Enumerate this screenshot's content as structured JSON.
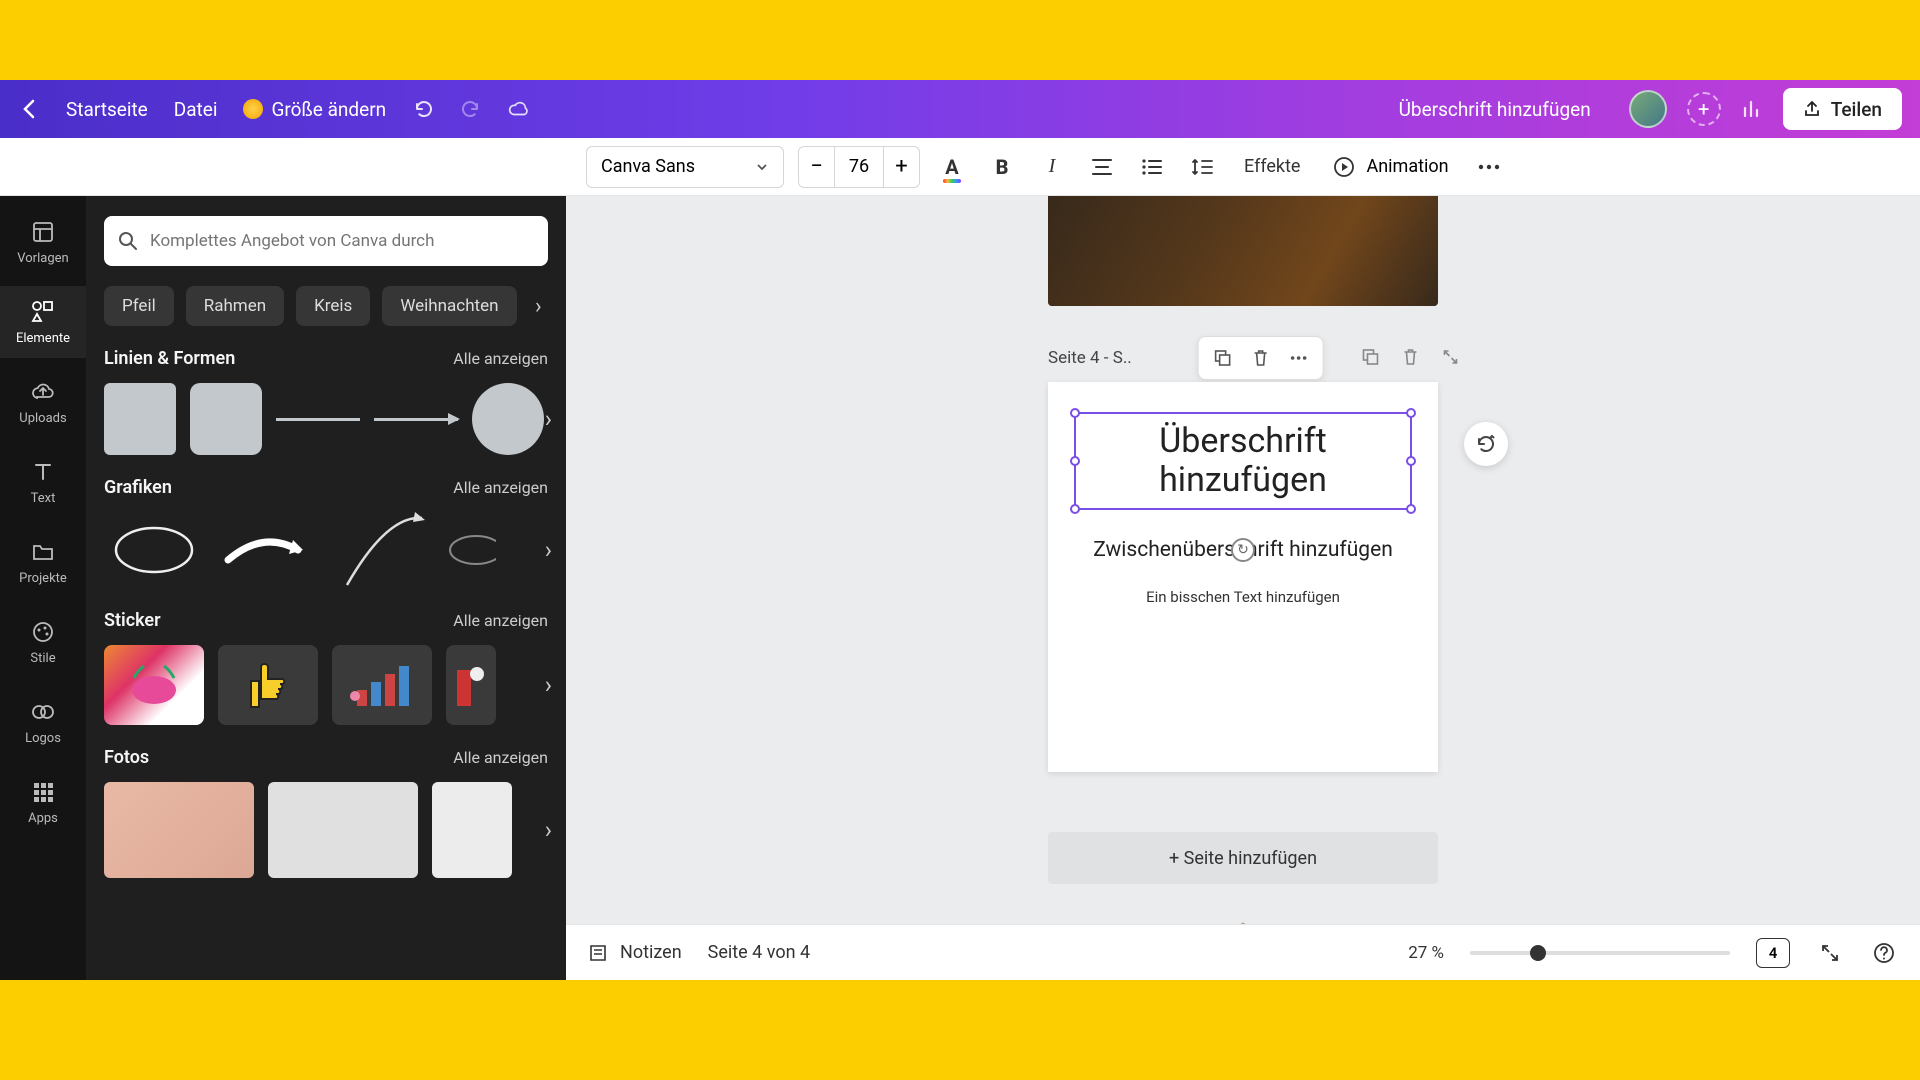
{
  "header": {
    "home": "Startseite",
    "file": "Datei",
    "resize": "Größe ändern",
    "doc_title": "Überschrift hinzufügen",
    "share": "Teilen"
  },
  "toolbar": {
    "font": "Canva Sans",
    "size": "76",
    "minus": "−",
    "plus": "+",
    "effects": "Effekte",
    "animation": "Animation"
  },
  "rail": {
    "templates": "Vorlagen",
    "elements": "Elemente",
    "uploads": "Uploads",
    "text": "Text",
    "projects": "Projekte",
    "styles": "Stile",
    "logos": "Logos",
    "apps": "Apps"
  },
  "panel": {
    "search_placeholder": "Komplettes Angebot von Canva durch",
    "chips": [
      "Pfeil",
      "Rahmen",
      "Kreis",
      "Weihnachten"
    ],
    "see_all": "Alle anzeigen",
    "sections": {
      "lines": "Linien & Formen",
      "graphics": "Grafiken",
      "sticker": "Sticker",
      "photos": "Fotos"
    }
  },
  "canvas": {
    "page_label": "Seite 4 - S..",
    "heading": "Überschrift hinzufügen",
    "subheading": "Zwischenüberschrift hinzufügen",
    "body": "Ein bisschen Text hinzufügen",
    "add_page": "+ Seite hinzufügen"
  },
  "bottom": {
    "notes": "Notizen",
    "page_of": "Seite 4 von 4",
    "zoom": "27 %",
    "page_badge": "4"
  }
}
